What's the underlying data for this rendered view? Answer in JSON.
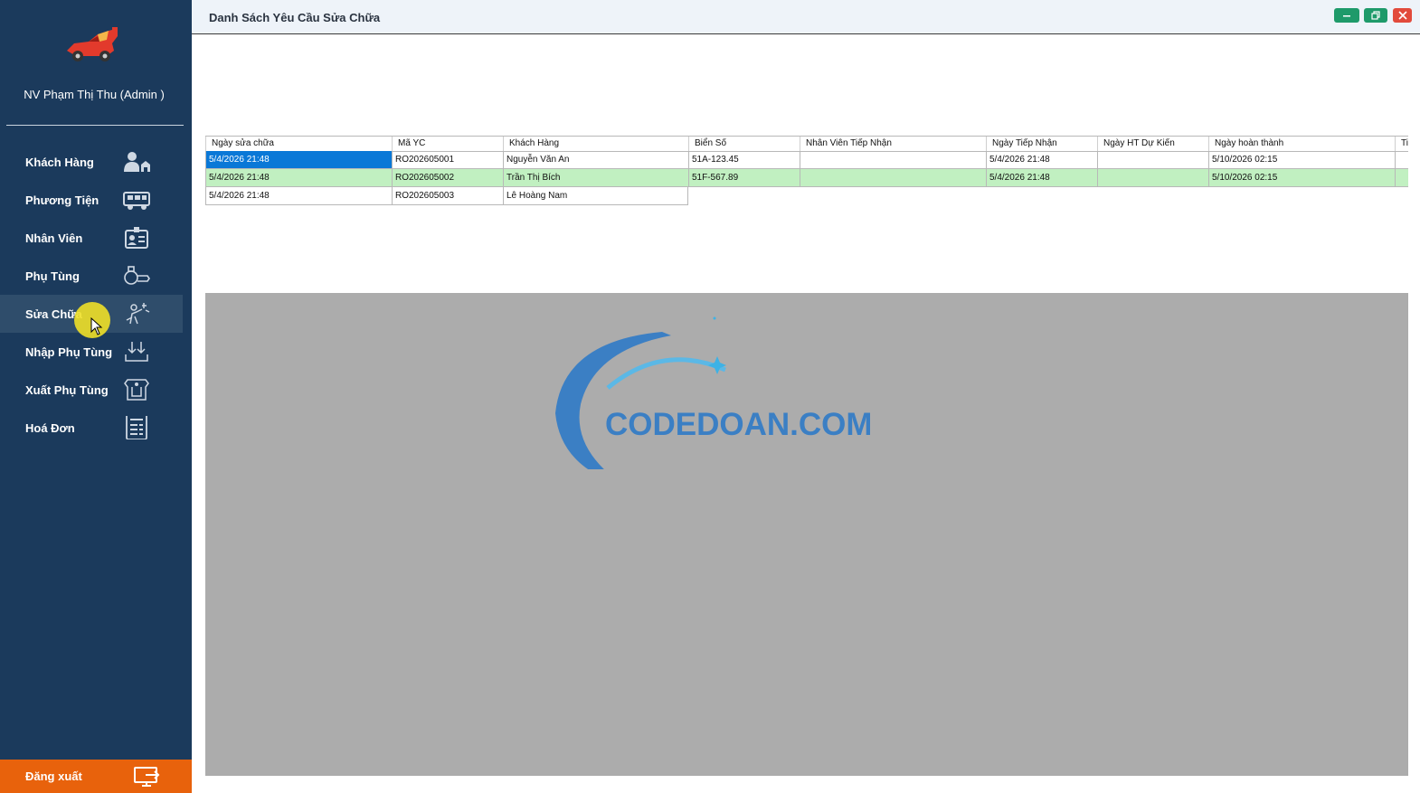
{
  "sidebar": {
    "user_name": "NV Phạm Thị Thu (Admin )",
    "items": [
      {
        "label": "Khách Hàng",
        "icon": "customer-icon"
      },
      {
        "label": "Phương Tiện",
        "icon": "vehicle-icon"
      },
      {
        "label": "Nhân Viên",
        "icon": "employee-id-icon"
      },
      {
        "label": "Phụ Tùng",
        "icon": "spare-part-icon"
      },
      {
        "label": "Sửa Chữa",
        "icon": "mechanic-icon",
        "active": true
      },
      {
        "label": "Nhập Phụ Tùng",
        "icon": "import-icon"
      },
      {
        "label": "Xuất Phụ Tùng",
        "icon": "export-icon"
      },
      {
        "label": "Hoá Đơn",
        "icon": "invoice-icon"
      }
    ],
    "logout_label": "Đăng xuất"
  },
  "window": {
    "title": "Danh Sách Yêu Cầu Sửa Chữa"
  },
  "grid": {
    "columns": [
      "Ngày sửa chữa",
      "Mã YC",
      "Khách Hàng",
      "Biển Số",
      "Nhân Viên Tiếp Nhận",
      "Ngày Tiếp Nhận",
      "Ngày HT Dự Kiến",
      "Ngày hoàn thành",
      "Ti"
    ],
    "rows": [
      [
        "5/4/2026 21:48",
        "RO202605001",
        "Nguyễn Văn An",
        "51A-123.45",
        "",
        "5/4/2026 21:48",
        "",
        "5/10/2026 02:15"
      ],
      [
        "5/4/2026 21:48",
        "RO202605002",
        "Trần Thị Bích",
        "51F-567.89",
        "",
        "5/4/2026 21:48",
        "",
        "5/10/2026 02:15"
      ],
      [
        "5/4/2026 21:48",
        "RO202605003",
        "Lê Hoàng Nam"
      ]
    ]
  },
  "colors": {
    "sidebar_bg": "#1b3a5c",
    "active_item_bg": "#2f4d6b",
    "logout_bg": "#e8620c",
    "selected_cell": "#0a78d7",
    "highlight_row": "#c1f0c1",
    "panel_bg": "#acacac"
  },
  "watermark": {
    "text": "CODEDOAN.COM"
  }
}
